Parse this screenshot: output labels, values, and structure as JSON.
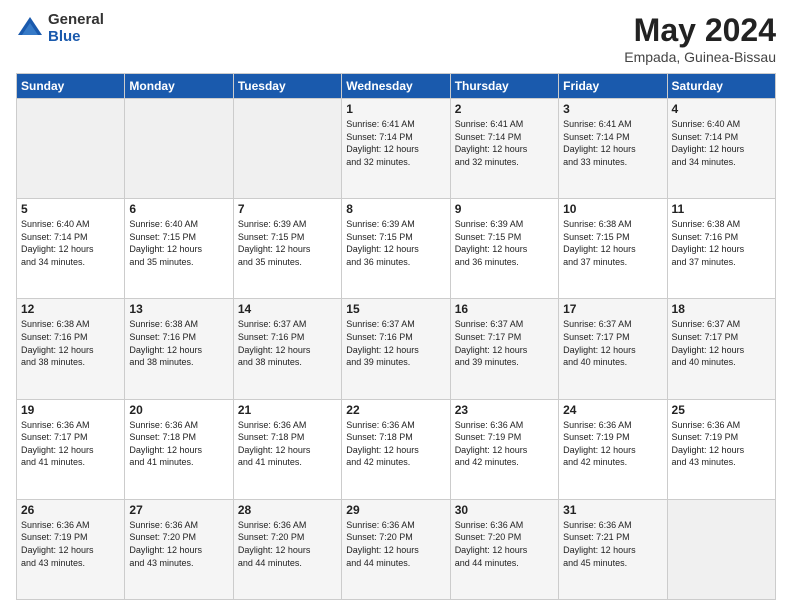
{
  "logo": {
    "general": "General",
    "blue": "Blue"
  },
  "title": "May 2024",
  "subtitle": "Empada, Guinea-Bissau",
  "days_of_week": [
    "Sunday",
    "Monday",
    "Tuesday",
    "Wednesday",
    "Thursday",
    "Friday",
    "Saturday"
  ],
  "weeks": [
    [
      {
        "day": "",
        "info": ""
      },
      {
        "day": "",
        "info": ""
      },
      {
        "day": "",
        "info": ""
      },
      {
        "day": "1",
        "info": "Sunrise: 6:41 AM\nSunset: 7:14 PM\nDaylight: 12 hours\nand 32 minutes."
      },
      {
        "day": "2",
        "info": "Sunrise: 6:41 AM\nSunset: 7:14 PM\nDaylight: 12 hours\nand 32 minutes."
      },
      {
        "day": "3",
        "info": "Sunrise: 6:41 AM\nSunset: 7:14 PM\nDaylight: 12 hours\nand 33 minutes."
      },
      {
        "day": "4",
        "info": "Sunrise: 6:40 AM\nSunset: 7:14 PM\nDaylight: 12 hours\nand 34 minutes."
      }
    ],
    [
      {
        "day": "5",
        "info": "Sunrise: 6:40 AM\nSunset: 7:14 PM\nDaylight: 12 hours\nand 34 minutes."
      },
      {
        "day": "6",
        "info": "Sunrise: 6:40 AM\nSunset: 7:15 PM\nDaylight: 12 hours\nand 35 minutes."
      },
      {
        "day": "7",
        "info": "Sunrise: 6:39 AM\nSunset: 7:15 PM\nDaylight: 12 hours\nand 35 minutes."
      },
      {
        "day": "8",
        "info": "Sunrise: 6:39 AM\nSunset: 7:15 PM\nDaylight: 12 hours\nand 36 minutes."
      },
      {
        "day": "9",
        "info": "Sunrise: 6:39 AM\nSunset: 7:15 PM\nDaylight: 12 hours\nand 36 minutes."
      },
      {
        "day": "10",
        "info": "Sunrise: 6:38 AM\nSunset: 7:15 PM\nDaylight: 12 hours\nand 37 minutes."
      },
      {
        "day": "11",
        "info": "Sunrise: 6:38 AM\nSunset: 7:16 PM\nDaylight: 12 hours\nand 37 minutes."
      }
    ],
    [
      {
        "day": "12",
        "info": "Sunrise: 6:38 AM\nSunset: 7:16 PM\nDaylight: 12 hours\nand 38 minutes."
      },
      {
        "day": "13",
        "info": "Sunrise: 6:38 AM\nSunset: 7:16 PM\nDaylight: 12 hours\nand 38 minutes."
      },
      {
        "day": "14",
        "info": "Sunrise: 6:37 AM\nSunset: 7:16 PM\nDaylight: 12 hours\nand 38 minutes."
      },
      {
        "day": "15",
        "info": "Sunrise: 6:37 AM\nSunset: 7:16 PM\nDaylight: 12 hours\nand 39 minutes."
      },
      {
        "day": "16",
        "info": "Sunrise: 6:37 AM\nSunset: 7:17 PM\nDaylight: 12 hours\nand 39 minutes."
      },
      {
        "day": "17",
        "info": "Sunrise: 6:37 AM\nSunset: 7:17 PM\nDaylight: 12 hours\nand 40 minutes."
      },
      {
        "day": "18",
        "info": "Sunrise: 6:37 AM\nSunset: 7:17 PM\nDaylight: 12 hours\nand 40 minutes."
      }
    ],
    [
      {
        "day": "19",
        "info": "Sunrise: 6:36 AM\nSunset: 7:17 PM\nDaylight: 12 hours\nand 41 minutes."
      },
      {
        "day": "20",
        "info": "Sunrise: 6:36 AM\nSunset: 7:18 PM\nDaylight: 12 hours\nand 41 minutes."
      },
      {
        "day": "21",
        "info": "Sunrise: 6:36 AM\nSunset: 7:18 PM\nDaylight: 12 hours\nand 41 minutes."
      },
      {
        "day": "22",
        "info": "Sunrise: 6:36 AM\nSunset: 7:18 PM\nDaylight: 12 hours\nand 42 minutes."
      },
      {
        "day": "23",
        "info": "Sunrise: 6:36 AM\nSunset: 7:19 PM\nDaylight: 12 hours\nand 42 minutes."
      },
      {
        "day": "24",
        "info": "Sunrise: 6:36 AM\nSunset: 7:19 PM\nDaylight: 12 hours\nand 42 minutes."
      },
      {
        "day": "25",
        "info": "Sunrise: 6:36 AM\nSunset: 7:19 PM\nDaylight: 12 hours\nand 43 minutes."
      }
    ],
    [
      {
        "day": "26",
        "info": "Sunrise: 6:36 AM\nSunset: 7:19 PM\nDaylight: 12 hours\nand 43 minutes."
      },
      {
        "day": "27",
        "info": "Sunrise: 6:36 AM\nSunset: 7:20 PM\nDaylight: 12 hours\nand 43 minutes."
      },
      {
        "day": "28",
        "info": "Sunrise: 6:36 AM\nSunset: 7:20 PM\nDaylight: 12 hours\nand 44 minutes."
      },
      {
        "day": "29",
        "info": "Sunrise: 6:36 AM\nSunset: 7:20 PM\nDaylight: 12 hours\nand 44 minutes."
      },
      {
        "day": "30",
        "info": "Sunrise: 6:36 AM\nSunset: 7:20 PM\nDaylight: 12 hours\nand 44 minutes."
      },
      {
        "day": "31",
        "info": "Sunrise: 6:36 AM\nSunset: 7:21 PM\nDaylight: 12 hours\nand 45 minutes."
      },
      {
        "day": "",
        "info": ""
      }
    ]
  ]
}
